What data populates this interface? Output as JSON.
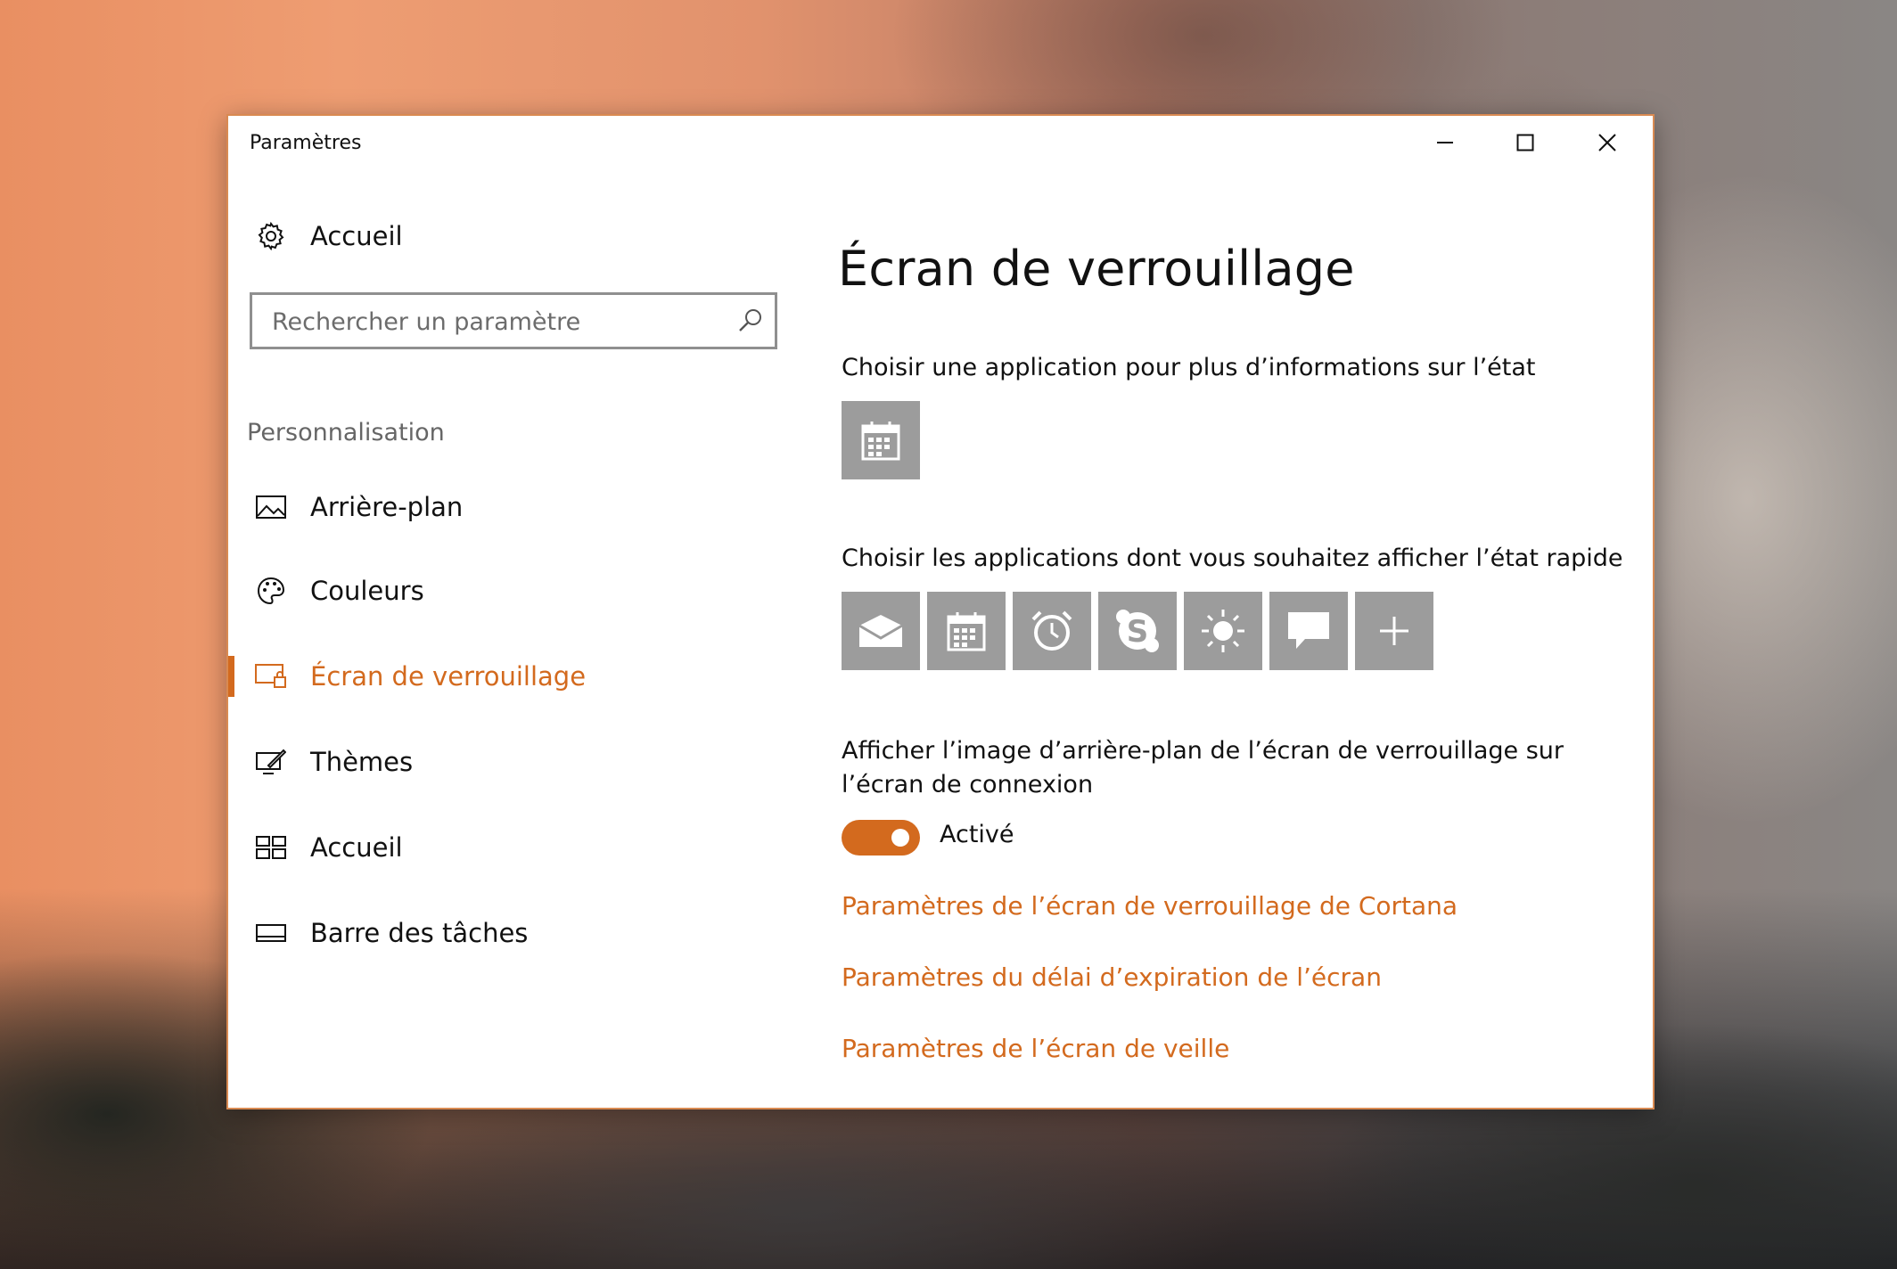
{
  "window": {
    "title": "Paramètres",
    "controls": {
      "minimize": "minimize-icon",
      "maximize": "maximize-icon",
      "close": "close-icon"
    }
  },
  "sidebar": {
    "home_label": "Accueil",
    "search_placeholder": "Rechercher un paramètre",
    "section_title": "Personnalisation",
    "items": [
      {
        "label": "Arrière-plan",
        "icon": "picture-icon",
        "active": false
      },
      {
        "label": "Couleurs",
        "icon": "palette-icon",
        "active": false
      },
      {
        "label": "Écran de verrouillage",
        "icon": "lock-screen-icon",
        "active": true
      },
      {
        "label": "Thèmes",
        "icon": "themes-icon",
        "active": false
      },
      {
        "label": "Accueil",
        "icon": "start-icon",
        "active": false
      },
      {
        "label": "Barre des tâches",
        "icon": "taskbar-icon",
        "active": false
      }
    ]
  },
  "main": {
    "title": "Écran de verrouillage",
    "detailed_status_label": "Choisir une application pour plus d’informations sur l’état",
    "detailed_status_app": "calendar-icon",
    "quick_status_label": "Choisir les applications dont vous souhaitez afficher l’état rapide",
    "quick_status_apps": [
      "mail-icon",
      "calendar-icon",
      "alarm-icon",
      "skype-icon",
      "weather-icon",
      "message-icon",
      "add-icon"
    ],
    "signin_bg_label": "Afficher l’image d’arrière-plan de l’écran de verrouillage sur l’écran de connexion",
    "toggle_state": "Activé",
    "links": [
      "Paramètres de l’écran de verrouillage de Cortana",
      "Paramètres du délai d’expiration de l’écran",
      "Paramètres de l’écran de veille"
    ]
  },
  "colors": {
    "accent": "#d36a1e",
    "tile": "#9c9c9c",
    "window_border": "#d98a52"
  }
}
